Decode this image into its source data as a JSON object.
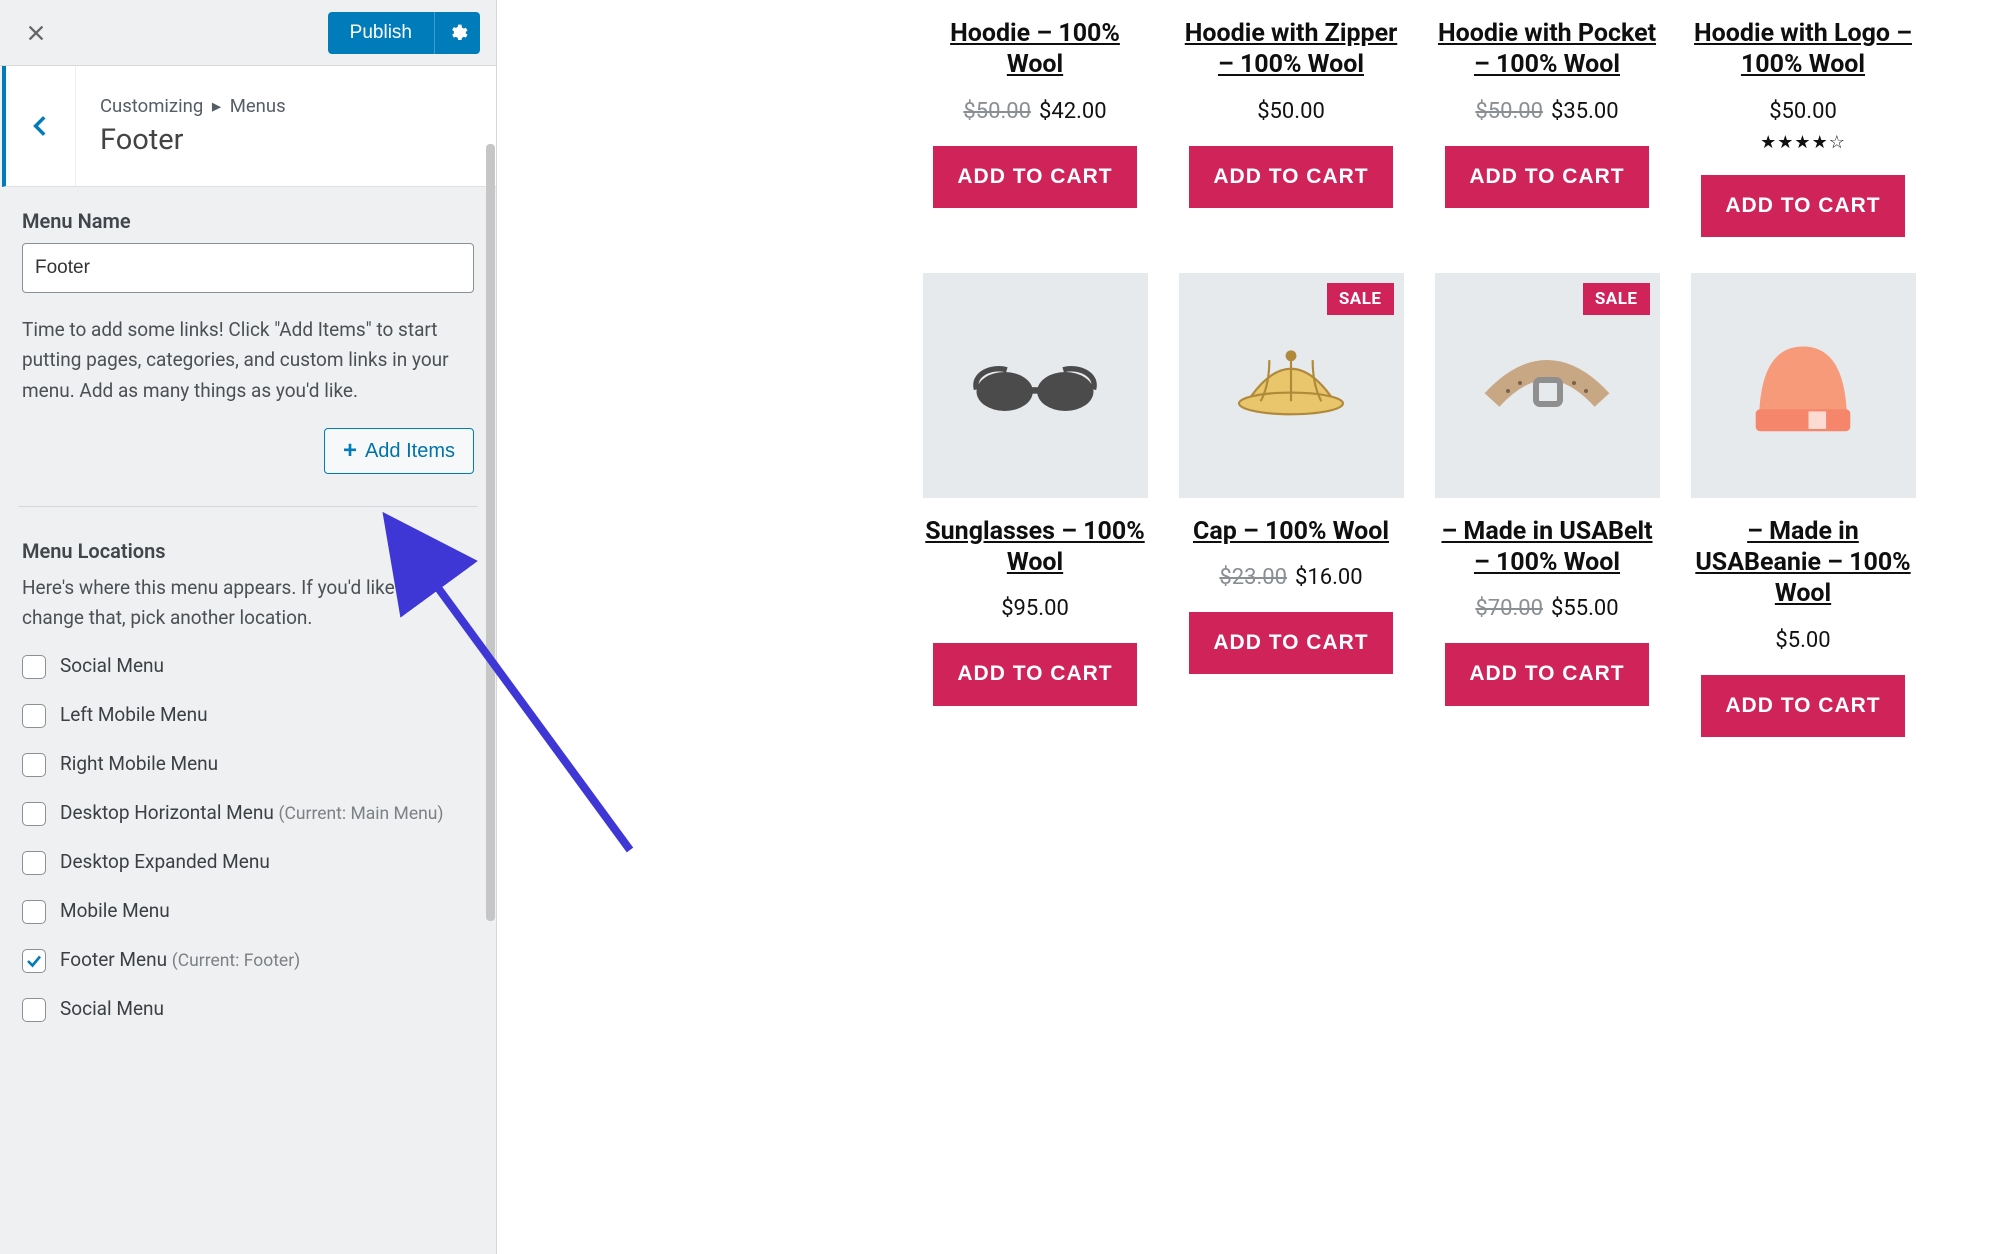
{
  "header": {
    "publish_label": "Publish"
  },
  "breadcrumb": {
    "root": "Customizing",
    "sep": "▸",
    "leaf": "Menus",
    "title": "Footer"
  },
  "menu_form": {
    "name_label": "Menu Name",
    "name_value": "Footer",
    "help_text": "Time to add some links! Click \"Add Items\" to start putting pages, categories, and custom links in your menu. Add as many things as you'd like.",
    "add_items_label": "Add Items"
  },
  "locations": {
    "heading": "Menu Locations",
    "desc": "Here's where this menu appears. If you'd like to change that, pick another location.",
    "items": [
      {
        "label": "Social Menu",
        "meta": "",
        "checked": false
      },
      {
        "label": "Left Mobile Menu",
        "meta": "",
        "checked": false
      },
      {
        "label": "Right Mobile Menu",
        "meta": "",
        "checked": false
      },
      {
        "label": "Desktop Horizontal Menu",
        "meta": "(Current: Main Menu)",
        "checked": false
      },
      {
        "label": "Desktop Expanded Menu",
        "meta": "",
        "checked": false
      },
      {
        "label": "Mobile Menu",
        "meta": "",
        "checked": false
      },
      {
        "label": "Footer Menu",
        "meta": "(Current: Footer)",
        "checked": true
      },
      {
        "label": "Social Menu",
        "meta": "",
        "checked": false
      }
    ]
  },
  "shop": {
    "sale_label": "SALE",
    "cart_label": "ADD TO CART",
    "products_row1": [
      {
        "title": "Hoodie – 100% Wool",
        "old_price": "$50.00",
        "price": "$42.00",
        "sale": false,
        "stars": ""
      },
      {
        "title": "Hoodie with Zipper – 100% Wool",
        "old_price": "",
        "price": "$50.00",
        "sale": false,
        "stars": ""
      },
      {
        "title": "Hoodie with Pocket – 100% Wool",
        "old_price": "$50.00",
        "price": "$35.00",
        "sale": false,
        "stars": ""
      },
      {
        "title": "Hoodie with Logo – 100% Wool",
        "old_price": "",
        "price": "$50.00",
        "sale": false,
        "stars": "★★★★☆"
      }
    ],
    "products_row2": [
      {
        "title": "Sunglasses – 100% Wool",
        "old_price": "",
        "price": "$95.00",
        "sale": false,
        "icon": "sunglasses"
      },
      {
        "title": "Cap – 100% Wool",
        "old_price": "$23.00",
        "price": "$16.00",
        "sale": true,
        "icon": "cap"
      },
      {
        "title": "– Made in USABelt – 100% Wool",
        "old_price": "$70.00",
        "price": "$55.00",
        "sale": true,
        "icon": "belt"
      },
      {
        "title": "– Made in USABeanie – 100% Wool",
        "old_price": "",
        "price": "$5.00",
        "sale": false,
        "icon": "beanie"
      }
    ]
  }
}
